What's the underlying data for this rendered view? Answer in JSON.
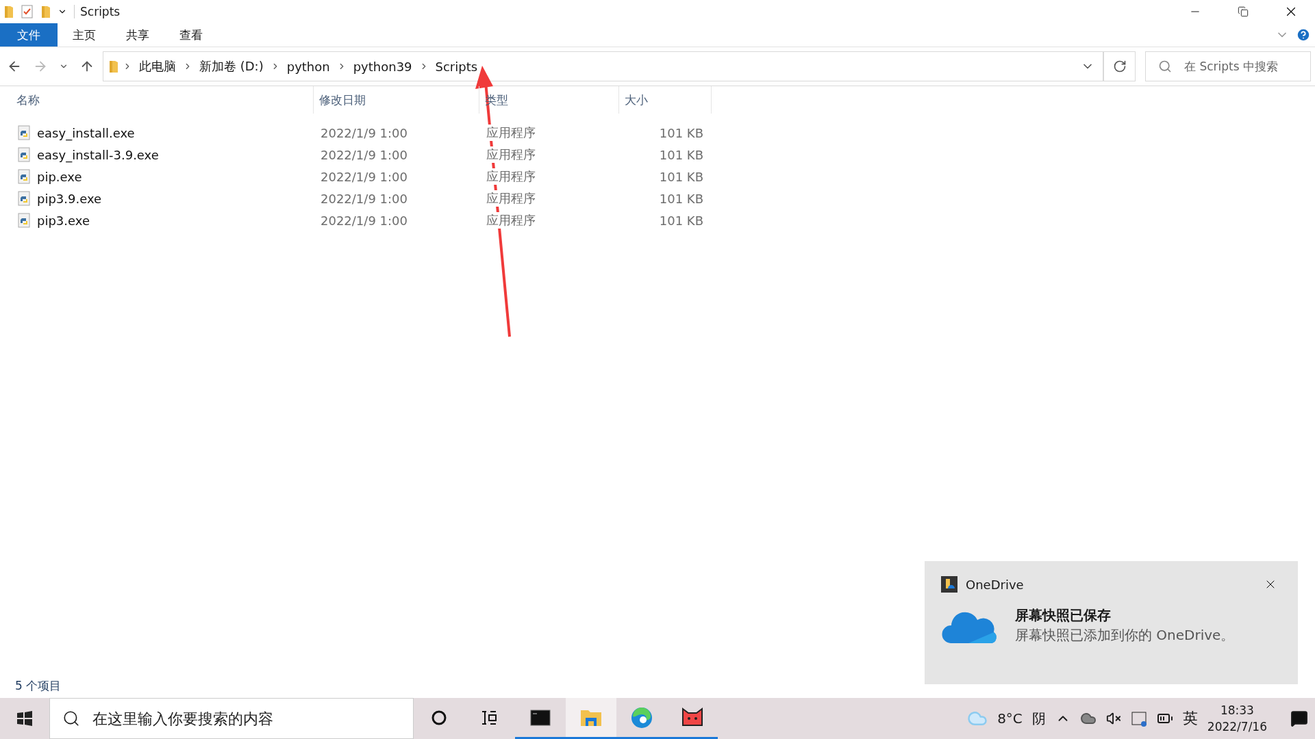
{
  "window": {
    "title": "Scripts"
  },
  "ribbon_tabs": [
    {
      "label": "文件",
      "selected": true
    },
    {
      "label": "主页",
      "selected": false
    },
    {
      "label": "共享",
      "selected": false
    },
    {
      "label": "查看",
      "selected": false
    }
  ],
  "address_bar": {
    "path": [
      "此电脑",
      "新加卷 (D:)",
      "python",
      "python39",
      "Scripts"
    ]
  },
  "search": {
    "placeholder": "在 Scripts 中搜索"
  },
  "table": {
    "columns": [
      "名称",
      "修改日期",
      "类型",
      "大小"
    ],
    "rows": [
      {
        "name": "easy_install.exe",
        "modified": "2022/1/9 1:00",
        "type": "应用程序",
        "size": "101 KB"
      },
      {
        "name": "easy_install-3.9.exe",
        "modified": "2022/1/9 1:00",
        "type": "应用程序",
        "size": "101 KB"
      },
      {
        "name": "pip.exe",
        "modified": "2022/1/9 1:00",
        "type": "应用程序",
        "size": "101 KB"
      },
      {
        "name": "pip3.9.exe",
        "modified": "2022/1/9 1:00",
        "type": "应用程序",
        "size": "101 KB"
      },
      {
        "name": "pip3.exe",
        "modified": "2022/1/9 1:00",
        "type": "应用程序",
        "size": "101 KB"
      }
    ]
  },
  "status_bar": {
    "item_count": "5 个项目"
  },
  "notification": {
    "app": "OneDrive",
    "title": "屏幕快照已保存",
    "message": "屏幕快照已添加到你的 OneDrive。"
  },
  "taskbar": {
    "search_placeholder": "在这里输入你要搜索的内容",
    "apps": [
      {
        "kind": "terminal",
        "selected": false
      },
      {
        "kind": "explorer",
        "selected": true
      },
      {
        "kind": "edge",
        "selected": false
      },
      {
        "kind": "cat",
        "selected": false
      }
    ],
    "temperature": "8°C",
    "condition": "阴",
    "input_method": "英",
    "time": "18:33",
    "date": "2022/7/16"
  }
}
